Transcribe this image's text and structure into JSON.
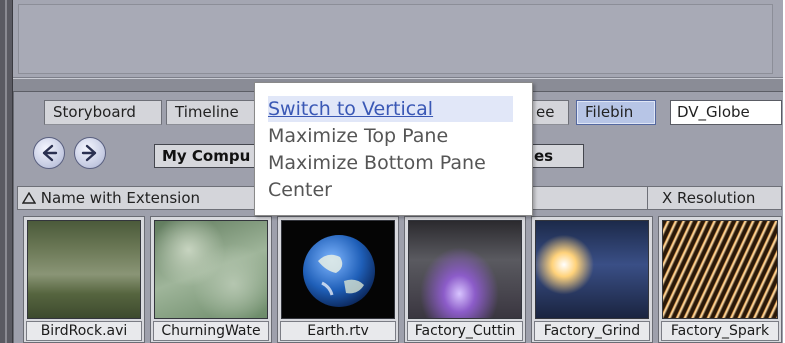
{
  "tabs": {
    "storyboard": "Storyboard",
    "timeline": "Timeline",
    "partial_hidden": "ee",
    "filebin": "Filebin"
  },
  "project_select": {
    "value": "DV_Globe"
  },
  "nav": {
    "back_icon": "left-arrow-icon",
    "forward_icon": "right-arrow-icon",
    "path_prefix": "My Compu",
    "path_suffix": "es"
  },
  "columns": {
    "name": "Name with Extension",
    "sort_icon": "sort-ascending-triangle-icon",
    "x_resolution": "X Resolution"
  },
  "files": [
    {
      "caption": "BirdRock.avi"
    },
    {
      "caption": "ChurningWate"
    },
    {
      "caption": "Earth.rtv"
    },
    {
      "caption": "Factory_Cuttin"
    },
    {
      "caption": "Factory_Grind"
    },
    {
      "caption": "Factory_Spark"
    }
  ],
  "context_menu": {
    "items": [
      {
        "label": "Switch to Vertical",
        "state": "hover"
      },
      {
        "label": "Maximize Top Pane"
      },
      {
        "label": "Maximize Bottom Pane"
      },
      {
        "label": "Center"
      }
    ]
  },
  "colors": {
    "accent": "#3a58b5",
    "active_tab": "#b7c5e6",
    "pane_bg": "#9ea0ac"
  }
}
